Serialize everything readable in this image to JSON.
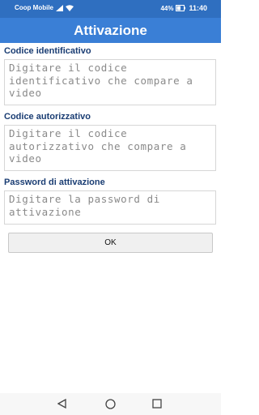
{
  "status_bar": {
    "carrier": "Coop Mobile",
    "battery": "44%",
    "time": "11:40"
  },
  "app_bar": {
    "title": "Attivazione"
  },
  "form": {
    "fields": [
      {
        "label": "Codice identificativo",
        "placeholder": "Digitare il codice identificativo che compare a video"
      },
      {
        "label": "Codice autorizzativo",
        "placeholder": "Digitare il codice autorizzativo che compare a video"
      },
      {
        "label": "Password di attivazione",
        "placeholder": "Digitare la password di attivazione"
      }
    ],
    "ok_label": "OK"
  },
  "nav_bar": {
    "icons": [
      "back-icon",
      "home-icon",
      "recents-icon"
    ]
  }
}
